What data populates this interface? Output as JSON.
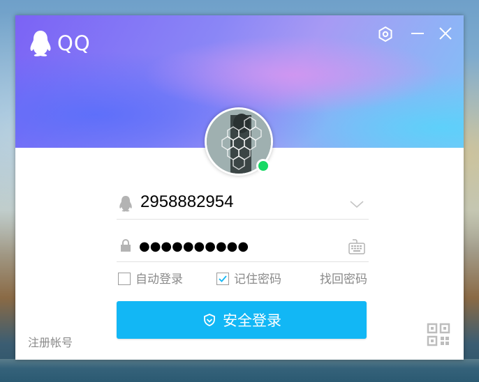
{
  "app": {
    "logo_text": "QQ"
  },
  "window_controls": {
    "settings_icon": "hexagon-settings-icon",
    "minimize_icon": "minimize-icon",
    "close_icon": "close-icon"
  },
  "profile": {
    "status": "online",
    "status_color": "#17d964"
  },
  "login_form": {
    "account": {
      "value": "2958882954",
      "icon": "penguin-icon",
      "dropdown_icon": "chevron-down-icon"
    },
    "password": {
      "masked_value": "●●●●●●●●●●",
      "icon": "lock-icon",
      "keyboard_icon": "keyboard-icon"
    },
    "options": {
      "auto_login": {
        "label": "自动登录",
        "checked": false
      },
      "remember_password": {
        "label": "记住密码",
        "checked": true
      },
      "find_password": "找回密码"
    },
    "login_button": {
      "label": "安全登录",
      "icon": "shield-icon",
      "color": "#12b7f5"
    }
  },
  "footer": {
    "register": "注册帐号",
    "qr_icon": "qr-code-icon"
  },
  "colors": {
    "accent": "#12b7f5",
    "header_purple": "#7b63f5",
    "header_cyan": "#7ec3f7"
  }
}
